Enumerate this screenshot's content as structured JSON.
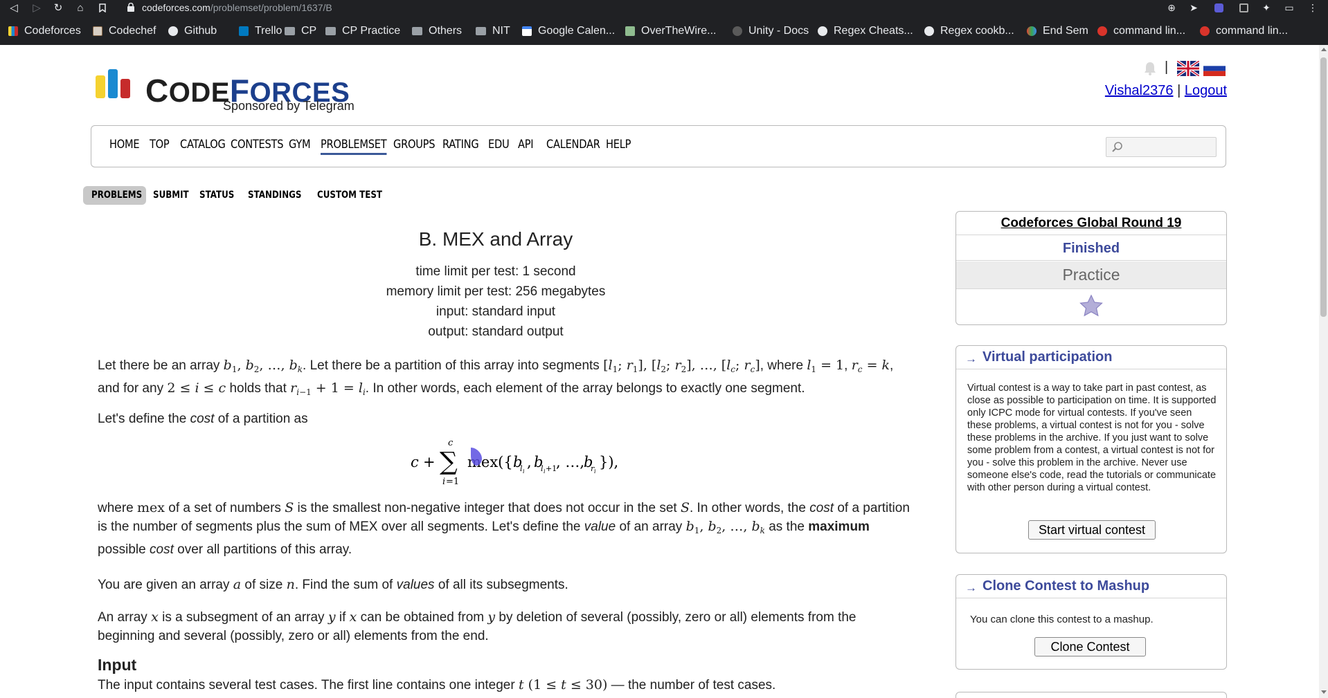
{
  "browser": {
    "url_host": "codeforces.com",
    "url_path": "/problemset/problem/1637/B",
    "bookmarks": [
      {
        "label": "Codeforces",
        "icon": "codeforces-icon"
      },
      {
        "label": "Codechef",
        "icon": "codechef-icon"
      },
      {
        "label": "Github",
        "icon": "github-icon"
      },
      {
        "label": "Trello",
        "icon": "trello-icon"
      },
      {
        "label": "CP",
        "icon": "folder-icon"
      },
      {
        "label": "CP Practice",
        "icon": "folder-icon"
      },
      {
        "label": "Others",
        "icon": "folder-icon"
      },
      {
        "label": "NIT",
        "icon": "folder-icon"
      },
      {
        "label": "Google Calen...",
        "icon": "google-calendar-icon"
      },
      {
        "label": "OverTheWire...",
        "icon": "overthewire-icon"
      },
      {
        "label": "Unity - Docs",
        "icon": "unity-icon"
      },
      {
        "label": "Regex Cheats...",
        "icon": "globe-icon"
      },
      {
        "label": "Regex cookb...",
        "icon": "globe-icon"
      },
      {
        "label": "End Sem",
        "icon": "end-sem-icon"
      },
      {
        "label": "command lin...",
        "icon": "ask-icon"
      },
      {
        "label": "command lin...",
        "icon": "ask-icon"
      }
    ]
  },
  "header": {
    "logo_word_first": "C",
    "logo_word_rest": "ODE",
    "logo_word_second": "F",
    "logo_word_second_rest": "ORCES",
    "sponsor": "Sponsored by Telegram",
    "username": "Vishal2376",
    "separator": "|",
    "logout": "Logout"
  },
  "menu": {
    "items": [
      "HOME",
      "TOP",
      "CATALOG",
      "CONTESTS",
      "GYM",
      "PROBLEMSET",
      "GROUPS",
      "RATING",
      "EDU",
      "API",
      "CALENDAR",
      "HELP"
    ],
    "active": "PROBLEMSET"
  },
  "submenu": {
    "items": [
      "PROBLEMS",
      "SUBMIT",
      "STATUS",
      "STANDINGS",
      "CUSTOM TEST"
    ],
    "active": "PROBLEMS"
  },
  "problem": {
    "title": "B. MEX and Array",
    "time_limit": "time limit per test: 1 second",
    "memory_limit": "memory limit per test: 256 megabytes",
    "input": "input: standard input",
    "output": "output: standard output",
    "p1_a": "Let there be an array ",
    "p1_b": ". Let there be a partition of this array into segments ",
    "p1_c": ", where ",
    "p1_d": ", and for any ",
    "p1_e": " holds that ",
    "p1_f": ". In other words, each element of the array belongs to exactly one segment.",
    "p2_a": "Let's define the ",
    "p2_cost": "cost",
    "p2_b": " of a partition as",
    "p3_a": "where ",
    "p3_b": " of a set of numbers ",
    "p3_c": " is the smallest non-negative integer that does not occur in the set ",
    "p3_d": ". In other words, the ",
    "p3_cost": "cost",
    "p3_e": " of a partition is the number of segments plus the sum of MEX over all segments. Let's define the ",
    "p3_value": "value",
    "p3_f": " of an array ",
    "p3_g": " as the ",
    "p3_max": "maximum",
    "p3_h": " possible ",
    "p3_cost2": "cost",
    "p3_i": " over all partitions of this array.",
    "p4_a": "You are given an array ",
    "p4_b": " of size ",
    "p4_c": ". Find the sum of ",
    "p4_values": "values",
    "p4_d": " of all its subsegments.",
    "p5_a": "An array ",
    "p5_b": " is a subsegment of an array ",
    "p5_c": " if ",
    "p5_d": " can be obtained from ",
    "p5_e": " by deletion of several (possibly, zero or all) elements from the beginning and several (possibly, zero or all) elements from the end.",
    "input_heading": "Input",
    "input_a": "The input contains several test cases. The first line contains one integer ",
    "input_b": " — the number of test cases."
  },
  "sidebar": {
    "contest_name": "Codeforces Global Round 19",
    "contest_status": "Finished",
    "contest_mode": "Practice",
    "virtual_title": "Virtual participation",
    "virtual_text": "Virtual contest is a way to take part in past contest, as close as possible to participation on time. It is supported only ICPC mode for virtual contests. If you've seen these problems, a virtual contest is not for you - solve these problems in the archive. If you just want to solve some problem from a contest, a virtual contest is not for you - solve this problem in the archive. Never use someone else's code, read the tutorials or communicate with other person during a virtual contest.",
    "virtual_button": "Start virtual contest",
    "clone_title": "Clone Contest to Mashup",
    "clone_text": "You can clone this contest to a mashup.",
    "clone_button": "Clone Contest",
    "arrow": "→"
  },
  "colors": {
    "link_blue": "#0000cc",
    "sidebar_title": "#3d4a9b",
    "logo_yellow": "#f5d230",
    "logo_blue": "#1a8ad1",
    "logo_red": "#c62b2b"
  }
}
